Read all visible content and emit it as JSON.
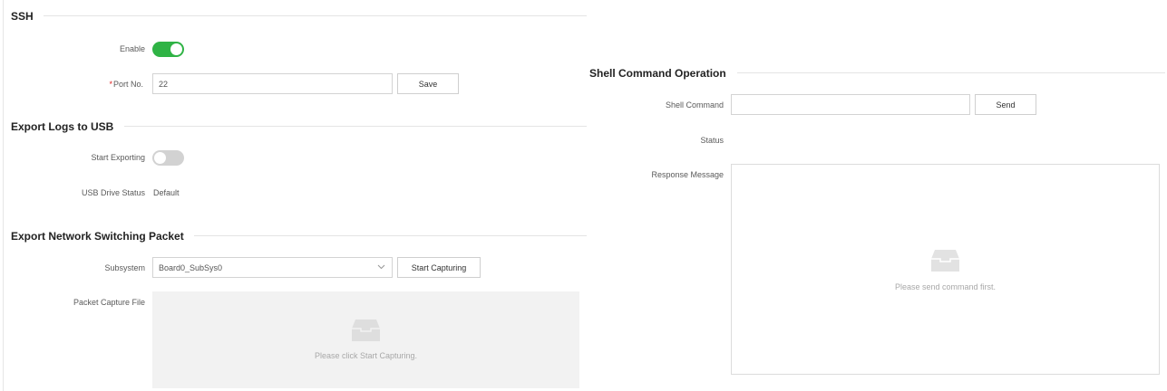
{
  "ssh": {
    "title": "SSH",
    "enable_label": "Enable",
    "enable_state": true,
    "port_label": "Port No.",
    "port_required_mark": "*",
    "port_value": "22",
    "save_label": "Save"
  },
  "export_logs": {
    "title": "Export Logs to USB",
    "start_exporting_label": "Start Exporting",
    "start_exporting_state": false,
    "usb_status_label": "USB Drive Status",
    "usb_status_value": "Default"
  },
  "export_packet": {
    "title": "Export Network Switching Packet",
    "subsystem_label": "Subsystem",
    "subsystem_value": "Board0_SubSys0",
    "start_capturing_label": "Start Capturing",
    "capture_file_label": "Packet Capture File",
    "capture_empty_text": "Please click Start Capturing."
  },
  "shell": {
    "title": "Shell Command Operation",
    "command_label": "Shell Command",
    "command_value": "",
    "send_label": "Send",
    "status_label": "Status",
    "status_value": "",
    "response_label": "Response Message",
    "response_empty_text": "Please send command first."
  },
  "colors": {
    "toggle_on": "#2fb345",
    "toggle_off": "#d2d2d2",
    "required": "#e02020"
  },
  "icons": {
    "empty_state": "inbox-icon",
    "select_arrow": "chevron-down-icon"
  }
}
